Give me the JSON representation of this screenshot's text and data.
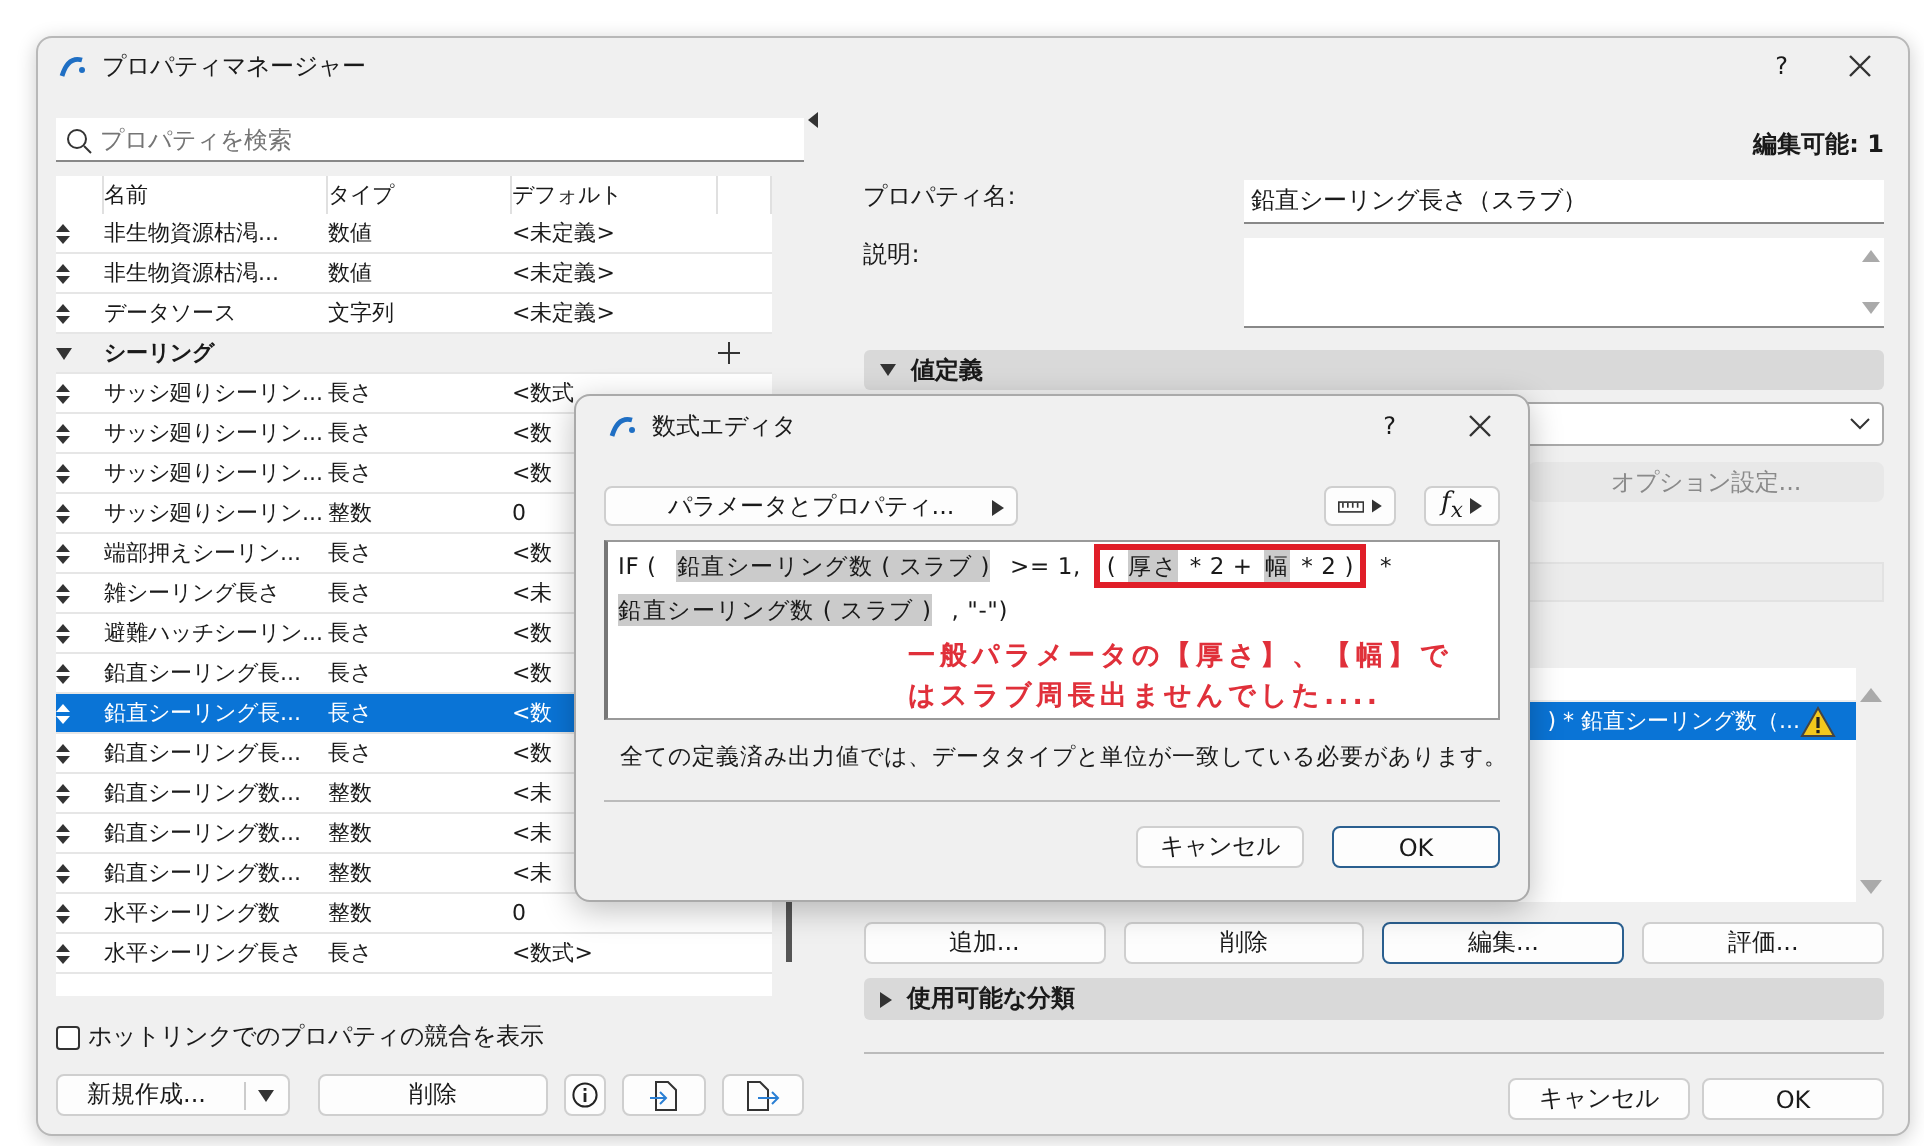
{
  "window": {
    "title": "プロパティマネージャー",
    "help": "?"
  },
  "search": {
    "placeholder": "プロパティを検索"
  },
  "table": {
    "columns": [
      "名前",
      "タイプ",
      "デフォルト"
    ],
    "rows": [
      {
        "kind": "property",
        "name": "非生物資源枯渇...",
        "type": "数値",
        "default": "<未定義>",
        "selected": false
      },
      {
        "kind": "property",
        "name": "非生物資源枯渇...",
        "type": "数値",
        "default": "<未定義>",
        "selected": false
      },
      {
        "kind": "property",
        "name": "データソース",
        "type": "文字列",
        "default": "<未定義>",
        "selected": false
      },
      {
        "kind": "group",
        "name": "シーリング",
        "expanded": true
      },
      {
        "kind": "property",
        "name": "サッシ廻りシーリン...",
        "type": "長さ",
        "default": "<数式",
        "selected": false
      },
      {
        "kind": "property",
        "name": "サッシ廻りシーリン...",
        "type": "長さ",
        "default": "<数",
        "selected": false
      },
      {
        "kind": "property",
        "name": "サッシ廻りシーリン...",
        "type": "長さ",
        "default": "<数",
        "selected": false
      },
      {
        "kind": "property",
        "name": "サッシ廻りシーリン...",
        "type": "整数",
        "default": "0",
        "selected": false
      },
      {
        "kind": "property",
        "name": "端部押えシーリン...",
        "type": "長さ",
        "default": "<数",
        "selected": false
      },
      {
        "kind": "property",
        "name": "雑シーリング長さ",
        "type": "長さ",
        "default": "<未",
        "selected": false
      },
      {
        "kind": "property",
        "name": "避難ハッチシーリン...",
        "type": "長さ",
        "default": "<数",
        "selected": false
      },
      {
        "kind": "property",
        "name": "鉛直シーリング長...",
        "type": "長さ",
        "default": "<数",
        "selected": false
      },
      {
        "kind": "property",
        "name": "鉛直シーリング長...",
        "type": "長さ",
        "default": "<数",
        "selected": true
      },
      {
        "kind": "property",
        "name": "鉛直シーリング長...",
        "type": "長さ",
        "default": "<数",
        "selected": false
      },
      {
        "kind": "property",
        "name": "鉛直シーリング数...",
        "type": "整数",
        "default": "<未",
        "selected": false
      },
      {
        "kind": "property",
        "name": "鉛直シーリング数...",
        "type": "整数",
        "default": "<未",
        "selected": false
      },
      {
        "kind": "property",
        "name": "鉛直シーリング数...",
        "type": "整数",
        "default": "<未",
        "selected": false
      },
      {
        "kind": "property",
        "name": "水平シーリング数",
        "type": "整数",
        "default": "0",
        "selected": false
      },
      {
        "kind": "property",
        "name": "水平シーリング長さ",
        "type": "長さ",
        "default": "<数式>",
        "selected": false
      }
    ]
  },
  "hotlink_checkbox": {
    "label": "ホットリンクでのプロパティの競合を表示",
    "checked": false
  },
  "left_buttons": {
    "new": "新規作成...",
    "delete": "削除"
  },
  "right_panel": {
    "editable": "編集可能: 1",
    "property_name_label": "プロパティ名:",
    "property_name": "鉛直シーリング長さ（スラブ）",
    "description_label": "説明:",
    "value_section": {
      "title": "値定義",
      "expanded": true
    },
    "options_button": {
      "label": "オプション設定...",
      "disabled": true
    },
    "value_list": [
      {
        "text": ") * 鉛直シーリング数（...",
        "selected": true,
        "warning": true
      }
    ],
    "list_buttons": [
      {
        "label": "追加...",
        "focused": false
      },
      {
        "label": "削除",
        "focused": false
      },
      {
        "label": "編集...",
        "focused": true
      },
      {
        "label": "評価...",
        "focused": false
      }
    ],
    "class_section": {
      "title": "使用可能な分類",
      "expanded": false
    },
    "buttons": [
      "キャンセル",
      "OK"
    ]
  },
  "formula_editor": {
    "title": "数式エディタ",
    "help": "?",
    "parameters_button": "パラメータとプロパティ...",
    "function_button": "f$_{x}$",
    "formula": [
      {
        "kind": "text",
        "text": "IF (",
        "framed": false
      },
      {
        "kind": "param",
        "text": "鉛直シーリング数 ( スラブ )",
        "framed": false
      },
      {
        "kind": "text",
        "text": ">= 1,",
        "framed": false
      },
      {
        "kind": "text",
        "text": "(",
        "framed": true
      },
      {
        "kind": "param",
        "text": "厚さ",
        "framed": true
      },
      {
        "kind": "text",
        "text": "* 2 +",
        "framed": true
      },
      {
        "kind": "param",
        "text": "幅",
        "framed": true
      },
      {
        "kind": "text",
        "text": "* 2 )",
        "framed": true
      },
      {
        "kind": "text",
        "text": "*",
        "framed": false
      },
      {
        "kind": "param",
        "text": "鉛直シーリング数 ( スラブ )",
        "framed": false
      },
      {
        "kind": "text",
        "text": ", \"-\")",
        "framed": false
      }
    ],
    "annotation": [
      "一般パラメータの【厚さ】、【幅】で",
      "はスラブ周長出ませんでした...."
    ],
    "warning": "全ての定義済み出力値では、データタイプと単位が一致している必要があります。",
    "buttons": [
      {
        "label": "キャンセル",
        "default": false
      },
      {
        "label": "OK",
        "default": true
      }
    ]
  }
}
